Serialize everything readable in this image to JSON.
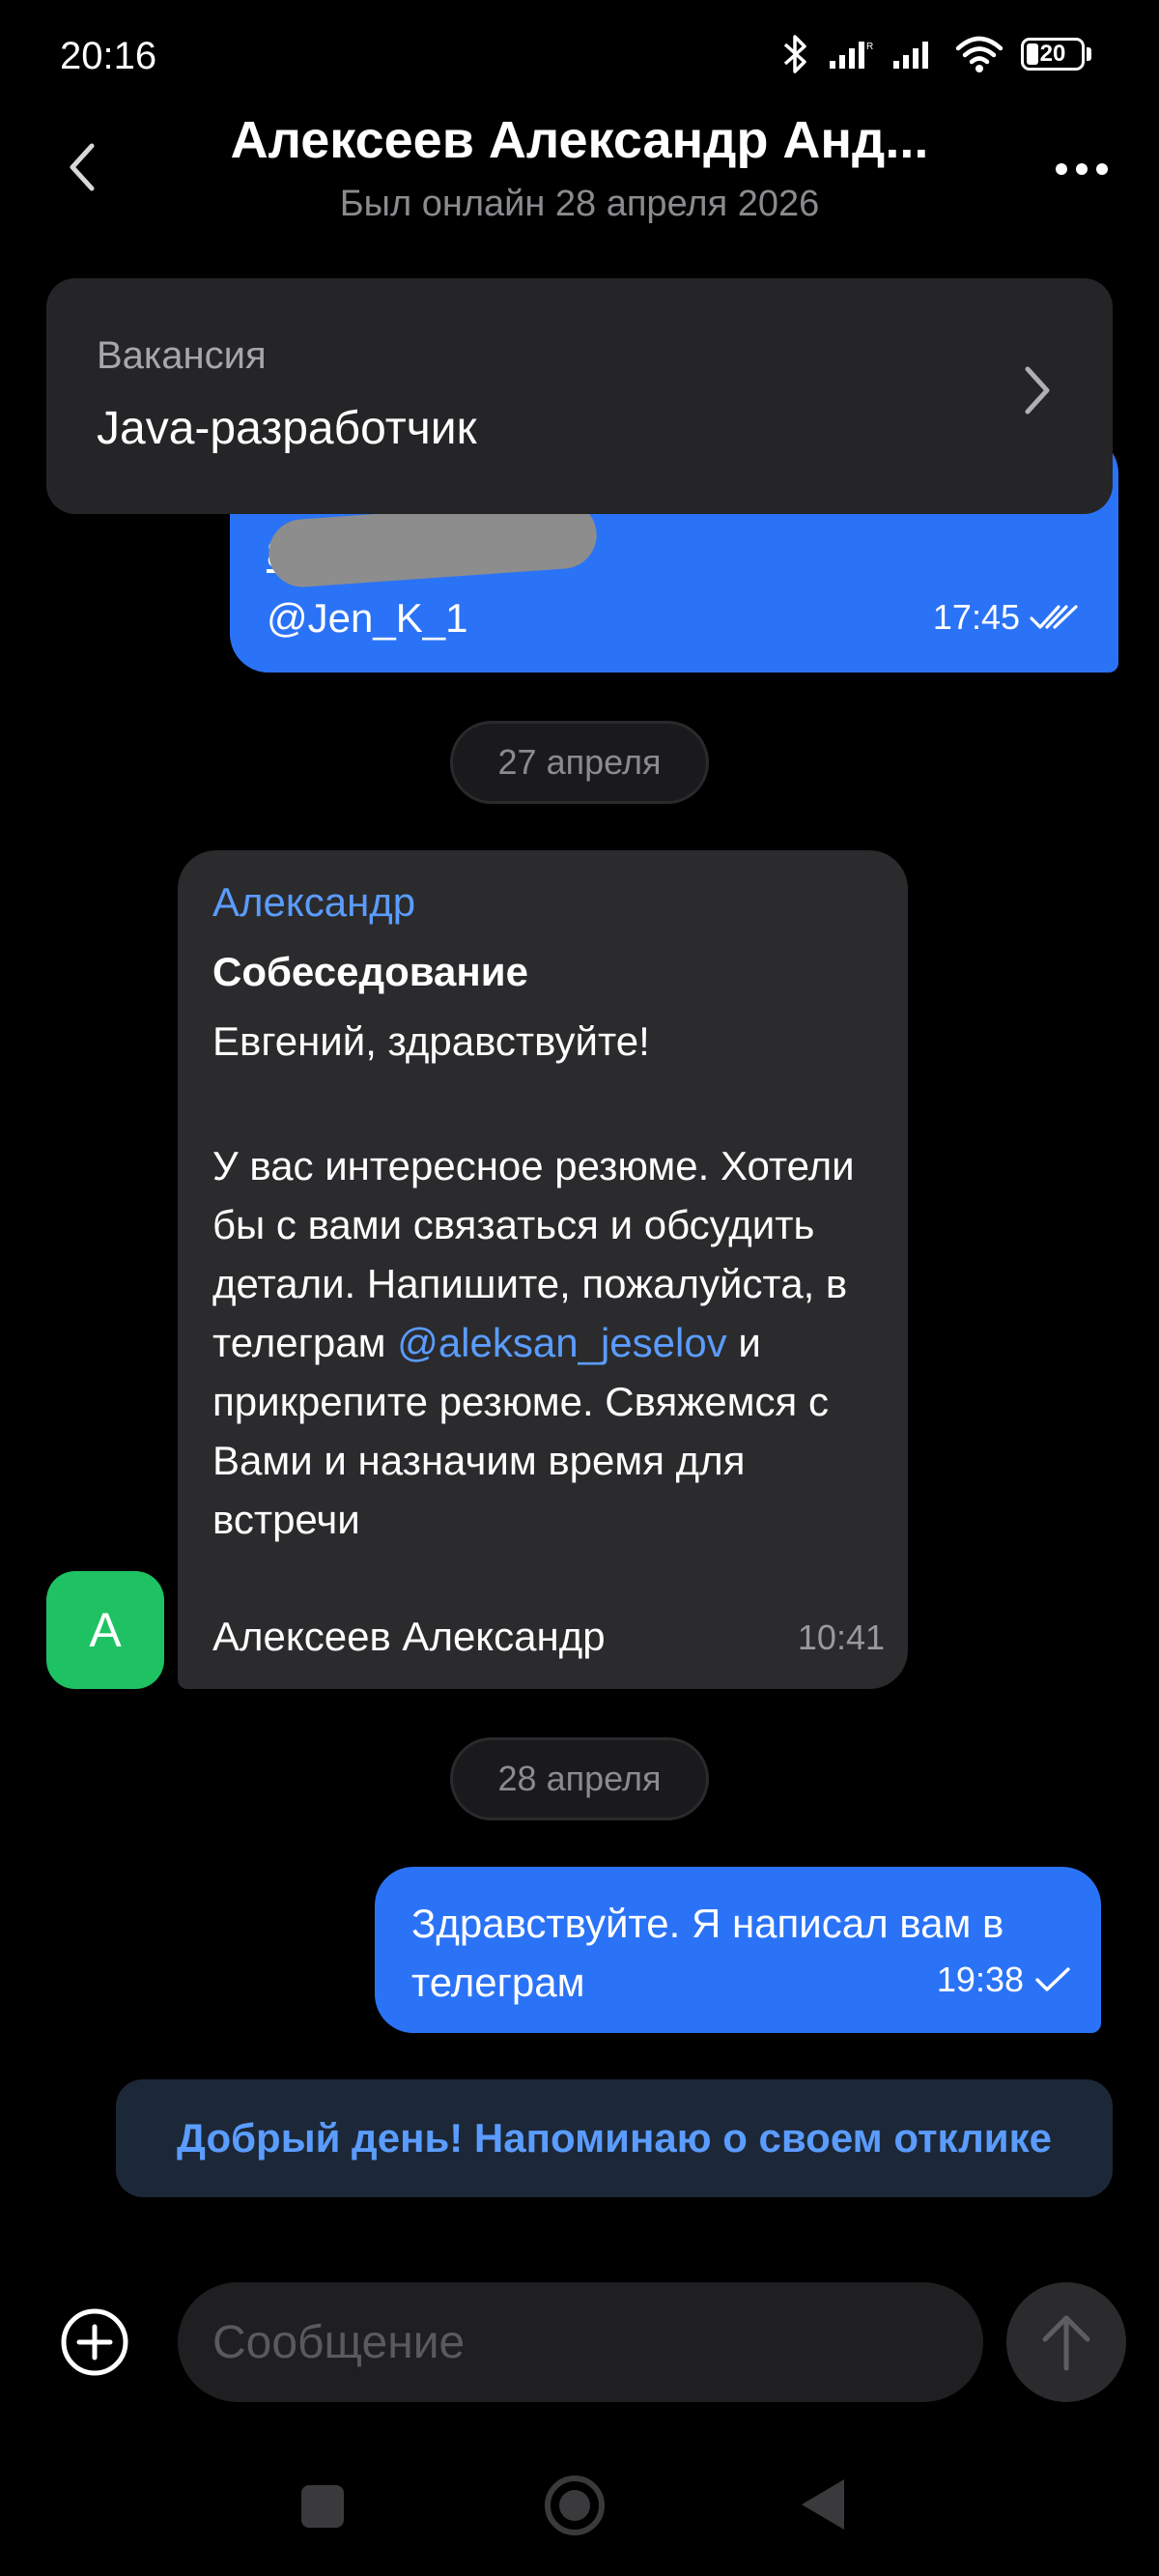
{
  "status_bar": {
    "time": "20:16",
    "battery": "20"
  },
  "header": {
    "title": "Алексеев Александр Анд...",
    "subtitle": "Был онлайн 28 апреля 2026"
  },
  "vacancy": {
    "label": "Вакансия",
    "value": "Java-разработчик"
  },
  "messages": {
    "first_outgoing": {
      "hidden_phone": "89",
      "handle": "@Jen_K_1",
      "time": "17:45",
      "status": "read"
    },
    "date_1": "27 апреля",
    "incoming": {
      "avatar_letter": "А",
      "sender": "Александр",
      "subject": "Собеседование",
      "greeting": "Евгений, здравствуйте!",
      "body_part1": "У вас интересное резюме. Хотели бы с вами связаться и обсудить детали. Напишите, пожалуйста,  в телеграм ",
      "link": "@aleksan_jeselov",
      "body_part2": " и прикрепите резюме. Свяжемся с Вами и назначим время для встречи",
      "signature": "Алексеев Александр",
      "time": "10:41"
    },
    "date_2": "28 апреля",
    "second_outgoing": {
      "text": "Здравствуйте. Я написал вам в телеграм",
      "time": "19:38",
      "status": "sent"
    }
  },
  "quick_reply": "Добрый день! Напоминаю о своем отклике",
  "composer": {
    "placeholder": "Сообщение"
  },
  "colors": {
    "outgoing_bubble": "#2b73f6",
    "incoming_bubble": "#2b2b2d",
    "link": "#5b9cff",
    "avatar": "#1ec262",
    "background": "#000000"
  }
}
